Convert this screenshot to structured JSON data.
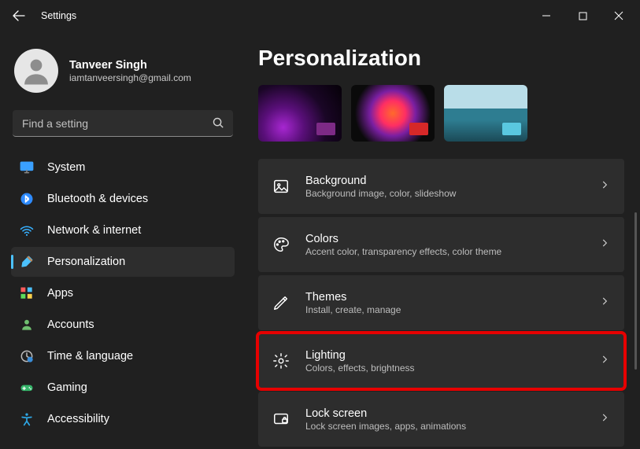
{
  "titlebar": {
    "title": "Settings"
  },
  "profile": {
    "name": "Tanveer Singh",
    "email": "iamtanveersingh@gmail.com"
  },
  "search": {
    "placeholder": "Find a setting"
  },
  "nav": {
    "items": [
      {
        "label": "System",
        "icon": "monitor"
      },
      {
        "label": "Bluetooth & devices",
        "icon": "bluetooth"
      },
      {
        "label": "Network & internet",
        "icon": "wifi"
      },
      {
        "label": "Personalization",
        "icon": "brush",
        "active": true
      },
      {
        "label": "Apps",
        "icon": "apps"
      },
      {
        "label": "Accounts",
        "icon": "person"
      },
      {
        "label": "Time & language",
        "icon": "clock-globe"
      },
      {
        "label": "Gaming",
        "icon": "gamepad"
      },
      {
        "label": "Accessibility",
        "icon": "accessibility"
      }
    ]
  },
  "page": {
    "title": "Personalization"
  },
  "cards": [
    {
      "title": "Background",
      "subtitle": "Background image, color, slideshow",
      "icon": "picture"
    },
    {
      "title": "Colors",
      "subtitle": "Accent color, transparency effects, color theme",
      "icon": "palette"
    },
    {
      "title": "Themes",
      "subtitle": "Install, create, manage",
      "icon": "pen"
    },
    {
      "title": "Lighting",
      "subtitle": "Colors, effects, brightness",
      "icon": "gear",
      "highlight": true
    },
    {
      "title": "Lock screen",
      "subtitle": "Lock screen images, apps, animations",
      "icon": "lockscreen"
    }
  ]
}
